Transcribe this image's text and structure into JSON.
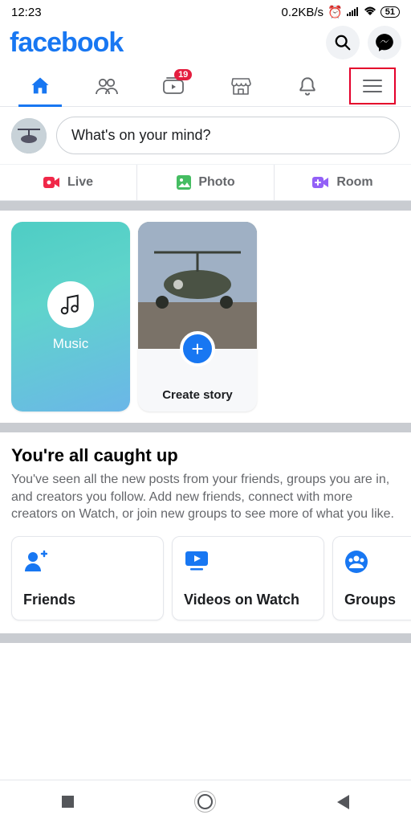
{
  "statusbar": {
    "time": "12:23",
    "speed": "0.2KB/s",
    "battery": "51"
  },
  "app": {
    "logo": "facebook"
  },
  "tabs": {
    "watch_badge": "19"
  },
  "composer": {
    "placeholder": "What's on your mind?"
  },
  "actions": {
    "live": "Live",
    "photo": "Photo",
    "room": "Room"
  },
  "stories": {
    "music": "Music",
    "create": "Create story"
  },
  "caught": {
    "title": "You're all caught up",
    "body": "You've seen all the new posts from your friends, groups you are in, and creators you follow. Add new friends, connect with more creators on Watch, or join new groups to see more of what you like."
  },
  "suggest": {
    "friends": "Friends",
    "videos": "Videos on Watch",
    "groups": "Groups"
  }
}
